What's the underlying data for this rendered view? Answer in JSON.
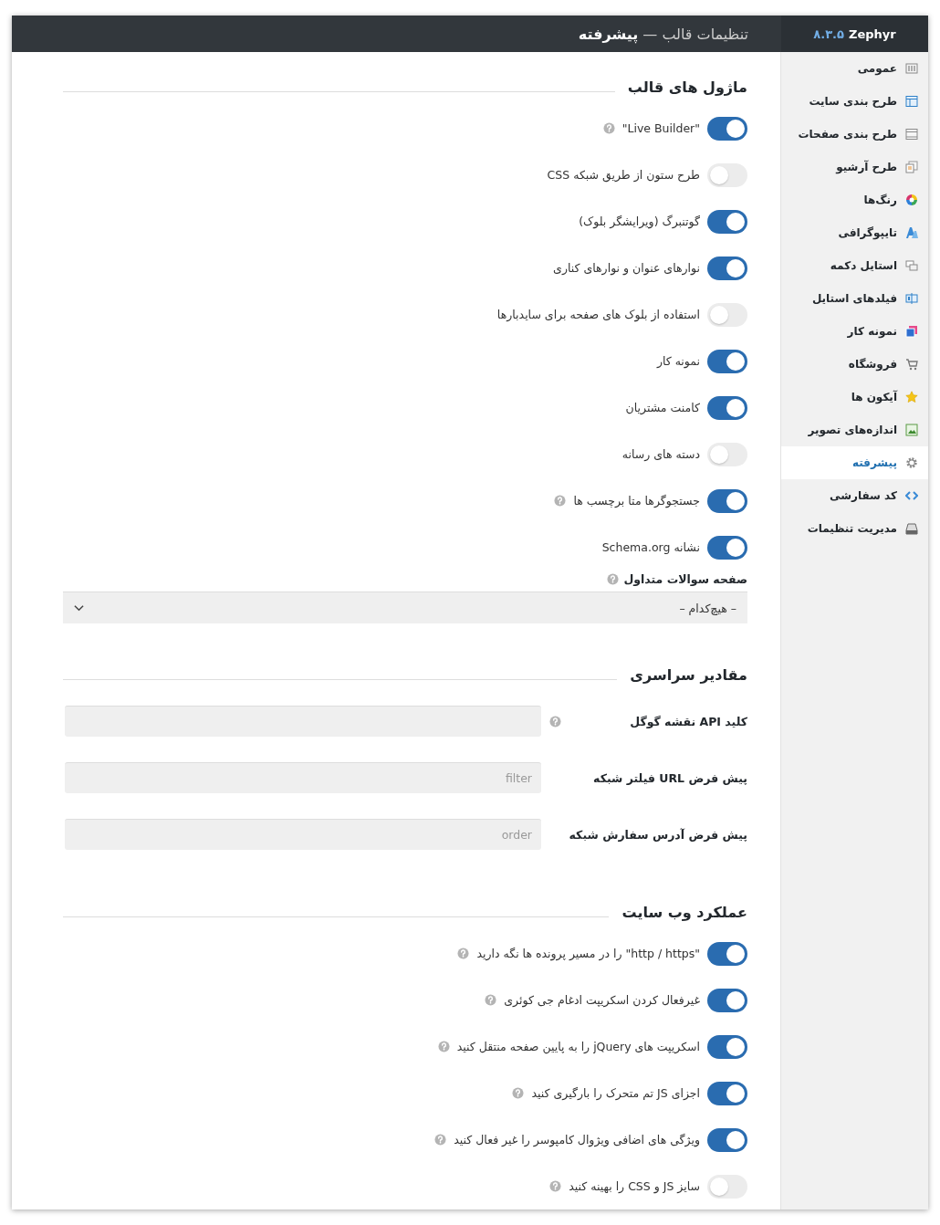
{
  "header": {
    "brand": "Zephyr",
    "version": "۸.۳.۵",
    "title": "تنظیمات قالب — **پیشرفته**"
  },
  "sidebar": {
    "items": [
      {
        "label": "عمومی",
        "selected": false
      },
      {
        "label": "طرح بندی سایت",
        "selected": false
      },
      {
        "label": "طرح بندی صفحات",
        "selected": false
      },
      {
        "label": "طرح آرشیو",
        "selected": false
      },
      {
        "label": "رنگ‌ها",
        "selected": false
      },
      {
        "label": "تایپوگرافی",
        "selected": false
      },
      {
        "label": "استایل دکمه",
        "selected": false
      },
      {
        "label": "فیلدهای استایل",
        "selected": false
      },
      {
        "label": "نمونه کار",
        "selected": false
      },
      {
        "label": "فروشگاه",
        "selected": false
      },
      {
        "label": "آیکون ها",
        "selected": false
      },
      {
        "label": "اندازه‌های تصویر",
        "selected": false
      },
      {
        "label": "پیشرفته",
        "selected": true
      },
      {
        "label": "کد سفارشی",
        "selected": false
      },
      {
        "label": "مدیریت تنظیمات",
        "selected": false
      }
    ]
  },
  "sections": [
    {
      "title": "ماژول های قالب",
      "items": [
        {
          "kind": "toggle",
          "label": "\"Live Builder\"",
          "on": true,
          "help": true
        },
        {
          "kind": "toggle",
          "label": "طرح ستون از طریق شبکه CSS",
          "on": false,
          "help": false
        },
        {
          "kind": "toggle",
          "label": "گوتنبرگ (ویرایشگر بلوک)",
          "on": true,
          "help": false
        },
        {
          "kind": "toggle",
          "label": "نوارهای عنوان و نوارهای کناری",
          "on": true,
          "help": false
        },
        {
          "kind": "toggle",
          "label": "استفاده از بلوک های صفحه برای سایدبارها",
          "on": false,
          "help": false
        },
        {
          "kind": "toggle",
          "label": "نمونه کار",
          "on": true,
          "help": false
        },
        {
          "kind": "toggle",
          "label": "کامنت مشتریان",
          "on": true,
          "help": false
        },
        {
          "kind": "toggle",
          "label": "دسته های رسانه",
          "on": false,
          "help": false
        },
        {
          "kind": "toggle",
          "label": "جستجوگرها متا برچسب ها",
          "on": true,
          "help": true
        },
        {
          "kind": "toggle",
          "label": "نشانه Schema.org",
          "on": true,
          "help": false
        },
        {
          "kind": "select",
          "label": "صفحه سوالات متداول",
          "help": true,
          "value": "– هیچ‌کدام –"
        }
      ]
    },
    {
      "title": "مقادیر سراسری",
      "items": [
        {
          "kind": "input",
          "label": "کلید API نقشه گوگل",
          "help": true
        },
        {
          "kind": "input",
          "label": "پیش فرض URL فیلتر شبکه",
          "help": false,
          "placeholder": "filter"
        },
        {
          "kind": "input",
          "label": "پیش فرض آدرس سفارش شبکه",
          "help": false,
          "placeholder": "order"
        }
      ]
    },
    {
      "title": "عملکرد وب سایت",
      "items": [
        {
          "kind": "toggle",
          "label": "\"http / https\" را در مسیر پرونده ها نگه دارید",
          "on": true,
          "help": true
        },
        {
          "kind": "toggle",
          "label": "غیرفعال کردن اسکریپت ادغام جی کوئری",
          "on": true,
          "help": true
        },
        {
          "kind": "toggle",
          "label": "اسکریپت های jQuery را به پایین صفحه منتقل کنید",
          "on": true,
          "help": true
        },
        {
          "kind": "toggle",
          "label": "اجزای JS تم متحرک را بارگیری کنید",
          "on": true,
          "help": true
        },
        {
          "kind": "toggle",
          "label": "ویژگی های اضافی ویژوال کامپوسر را غیر فعال کنید",
          "on": true,
          "help": true
        },
        {
          "kind": "toggle",
          "label": "سایز JS و CSS را بهینه کنید",
          "on": false,
          "help": true
        }
      ]
    }
  ]
}
